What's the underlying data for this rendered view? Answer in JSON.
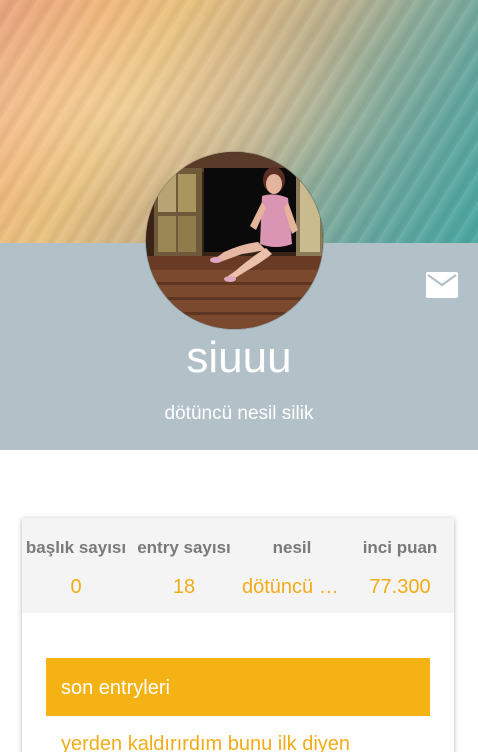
{
  "profile": {
    "username": "siuuu",
    "generation": "dötüncü nesil silik"
  },
  "icons": {
    "mail": "mail-icon"
  },
  "colors": {
    "band": "#b2c0c8",
    "accent": "#f4b215",
    "value_text": "#f2ac17",
    "label_text": "#7a7a7a"
  },
  "stats": [
    {
      "label": "başlık sayısı",
      "value": "0"
    },
    {
      "label": "entry sayısı",
      "value": "18"
    },
    {
      "label": "nesil",
      "value": "dötüncü n..."
    },
    {
      "label": "inci puan",
      "value": "77.300"
    }
  ],
  "entries": {
    "header": "son entryleri",
    "first_entry": "yerden kaldırırdım bunu ilk diyen"
  }
}
